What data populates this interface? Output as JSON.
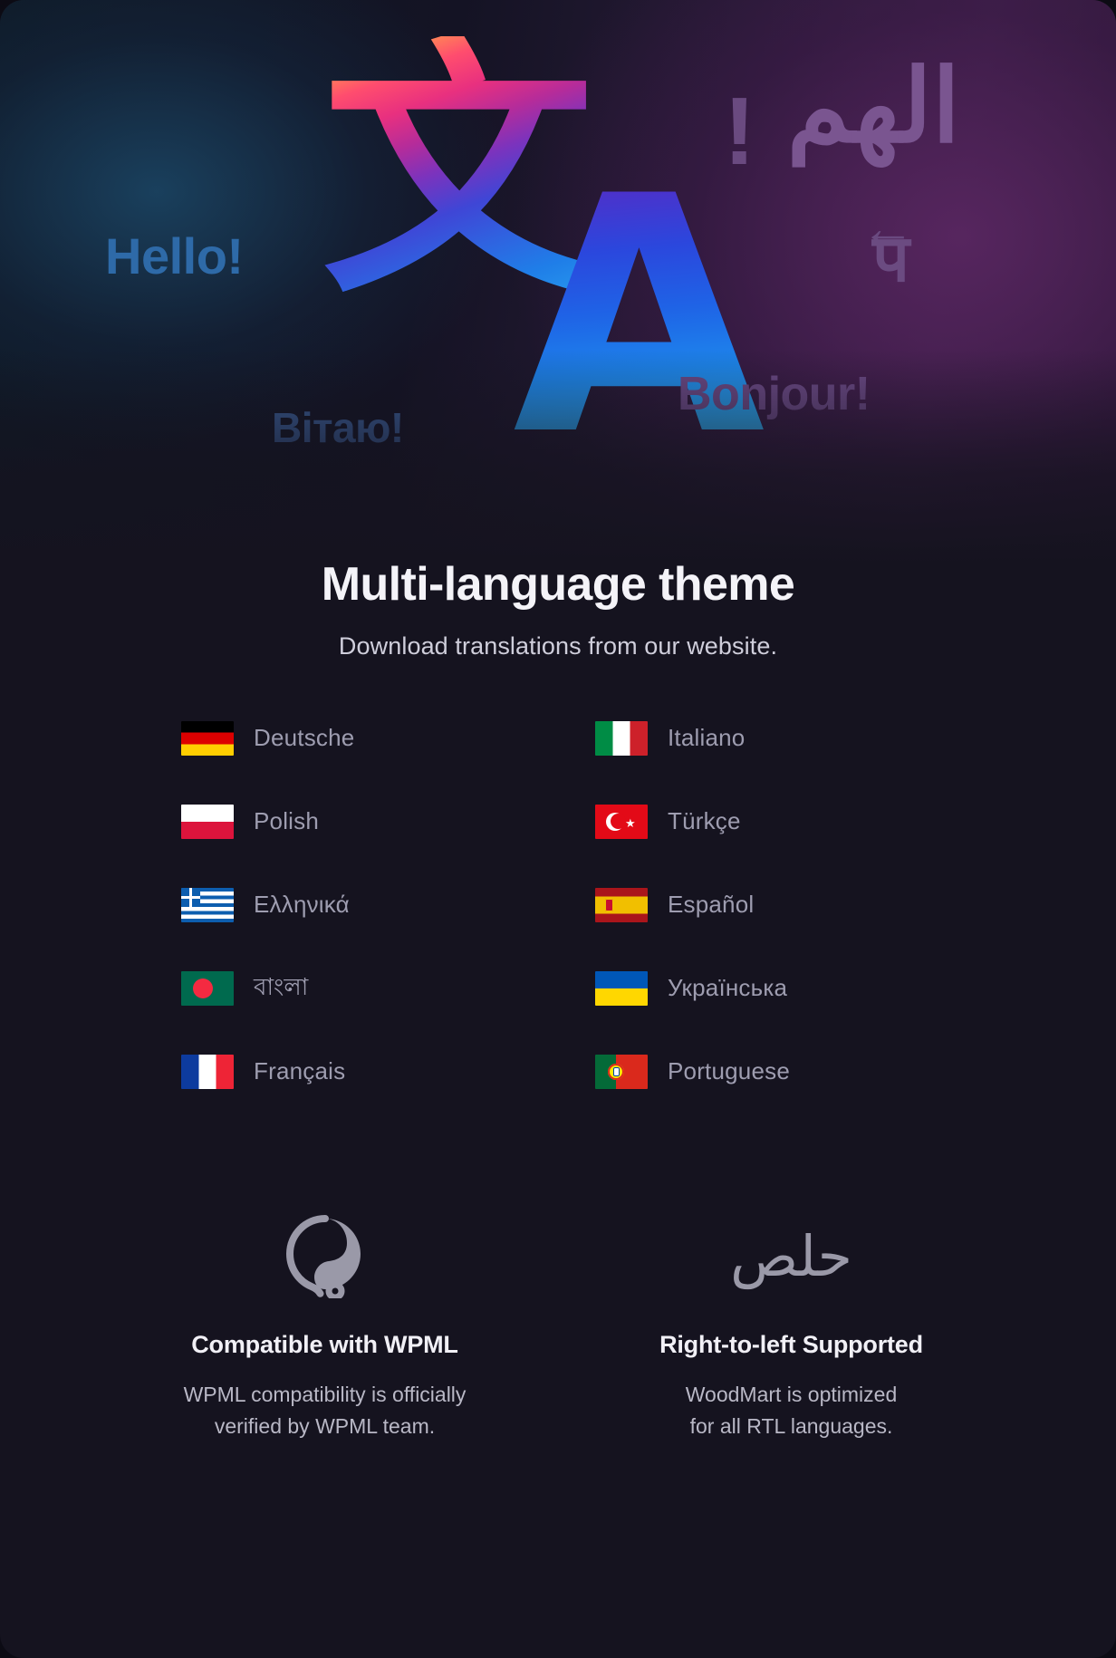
{
  "hero": {
    "greetings": [
      {
        "id": "hello",
        "text": "Hello!",
        "color": "#2e6aa8"
      },
      {
        "id": "vitayu",
        "text": "Вітаю!",
        "color": "#3a5d96"
      },
      {
        "id": "bonjour",
        "text": "Bonjour!",
        "color": "#6c4a86"
      }
    ],
    "marks": {
      "arabic": "الهم",
      "exclamation": "!",
      "arrow": "←",
      "devanagari": "प"
    },
    "glyph": {
      "cjk": "文",
      "latin": "A"
    }
  },
  "headings": {
    "title": "Multi-language theme",
    "subtitle": "Download translations from our website."
  },
  "languages": [
    {
      "label": "Deutsche",
      "flag": "flag-de",
      "flag_name": "germany-flag"
    },
    {
      "label": "Italiano",
      "flag": "flag-it",
      "flag_name": "italy-flag"
    },
    {
      "label": "Polish",
      "flag": "flag-pl",
      "flag_name": "poland-flag"
    },
    {
      "label": "Türkçe",
      "flag": "flag-tr",
      "flag_name": "turkey-flag"
    },
    {
      "label": "Ελληνικά",
      "flag": "flag-gr",
      "flag_name": "greece-flag"
    },
    {
      "label": "Español",
      "flag": "flag-es",
      "flag_name": "spain-flag"
    },
    {
      "label": "বাংলা",
      "flag": "flag-bd",
      "flag_name": "bangladesh-flag"
    },
    {
      "label": "Українська",
      "flag": "flag-ua",
      "flag_name": "ukraine-flag"
    },
    {
      "label": "Français",
      "flag": "flag-fr",
      "flag_name": "france-flag"
    },
    {
      "label": "Portuguese",
      "flag": "flag-pt",
      "flag_name": "portugal-flag"
    }
  ],
  "features": [
    {
      "icon": "wpml-logo-icon",
      "title": "Compatible with WPML",
      "desc_line1": "WPML compatibility  is officially",
      "desc_line2": "verified by WPML team."
    },
    {
      "icon": "arabic-script-icon",
      "icon_text": "حلص",
      "title": "Right-to-left Supported",
      "desc_line1": "WoodMart is optimized",
      "desc_line2": "for all RTL  languages."
    }
  ],
  "colors": {
    "background": "#15131f",
    "title": "#f4f3f8",
    "subtitle": "#cfcedb",
    "language_label": "#9e9db0",
    "feature_desc": "#b9b8c6"
  }
}
